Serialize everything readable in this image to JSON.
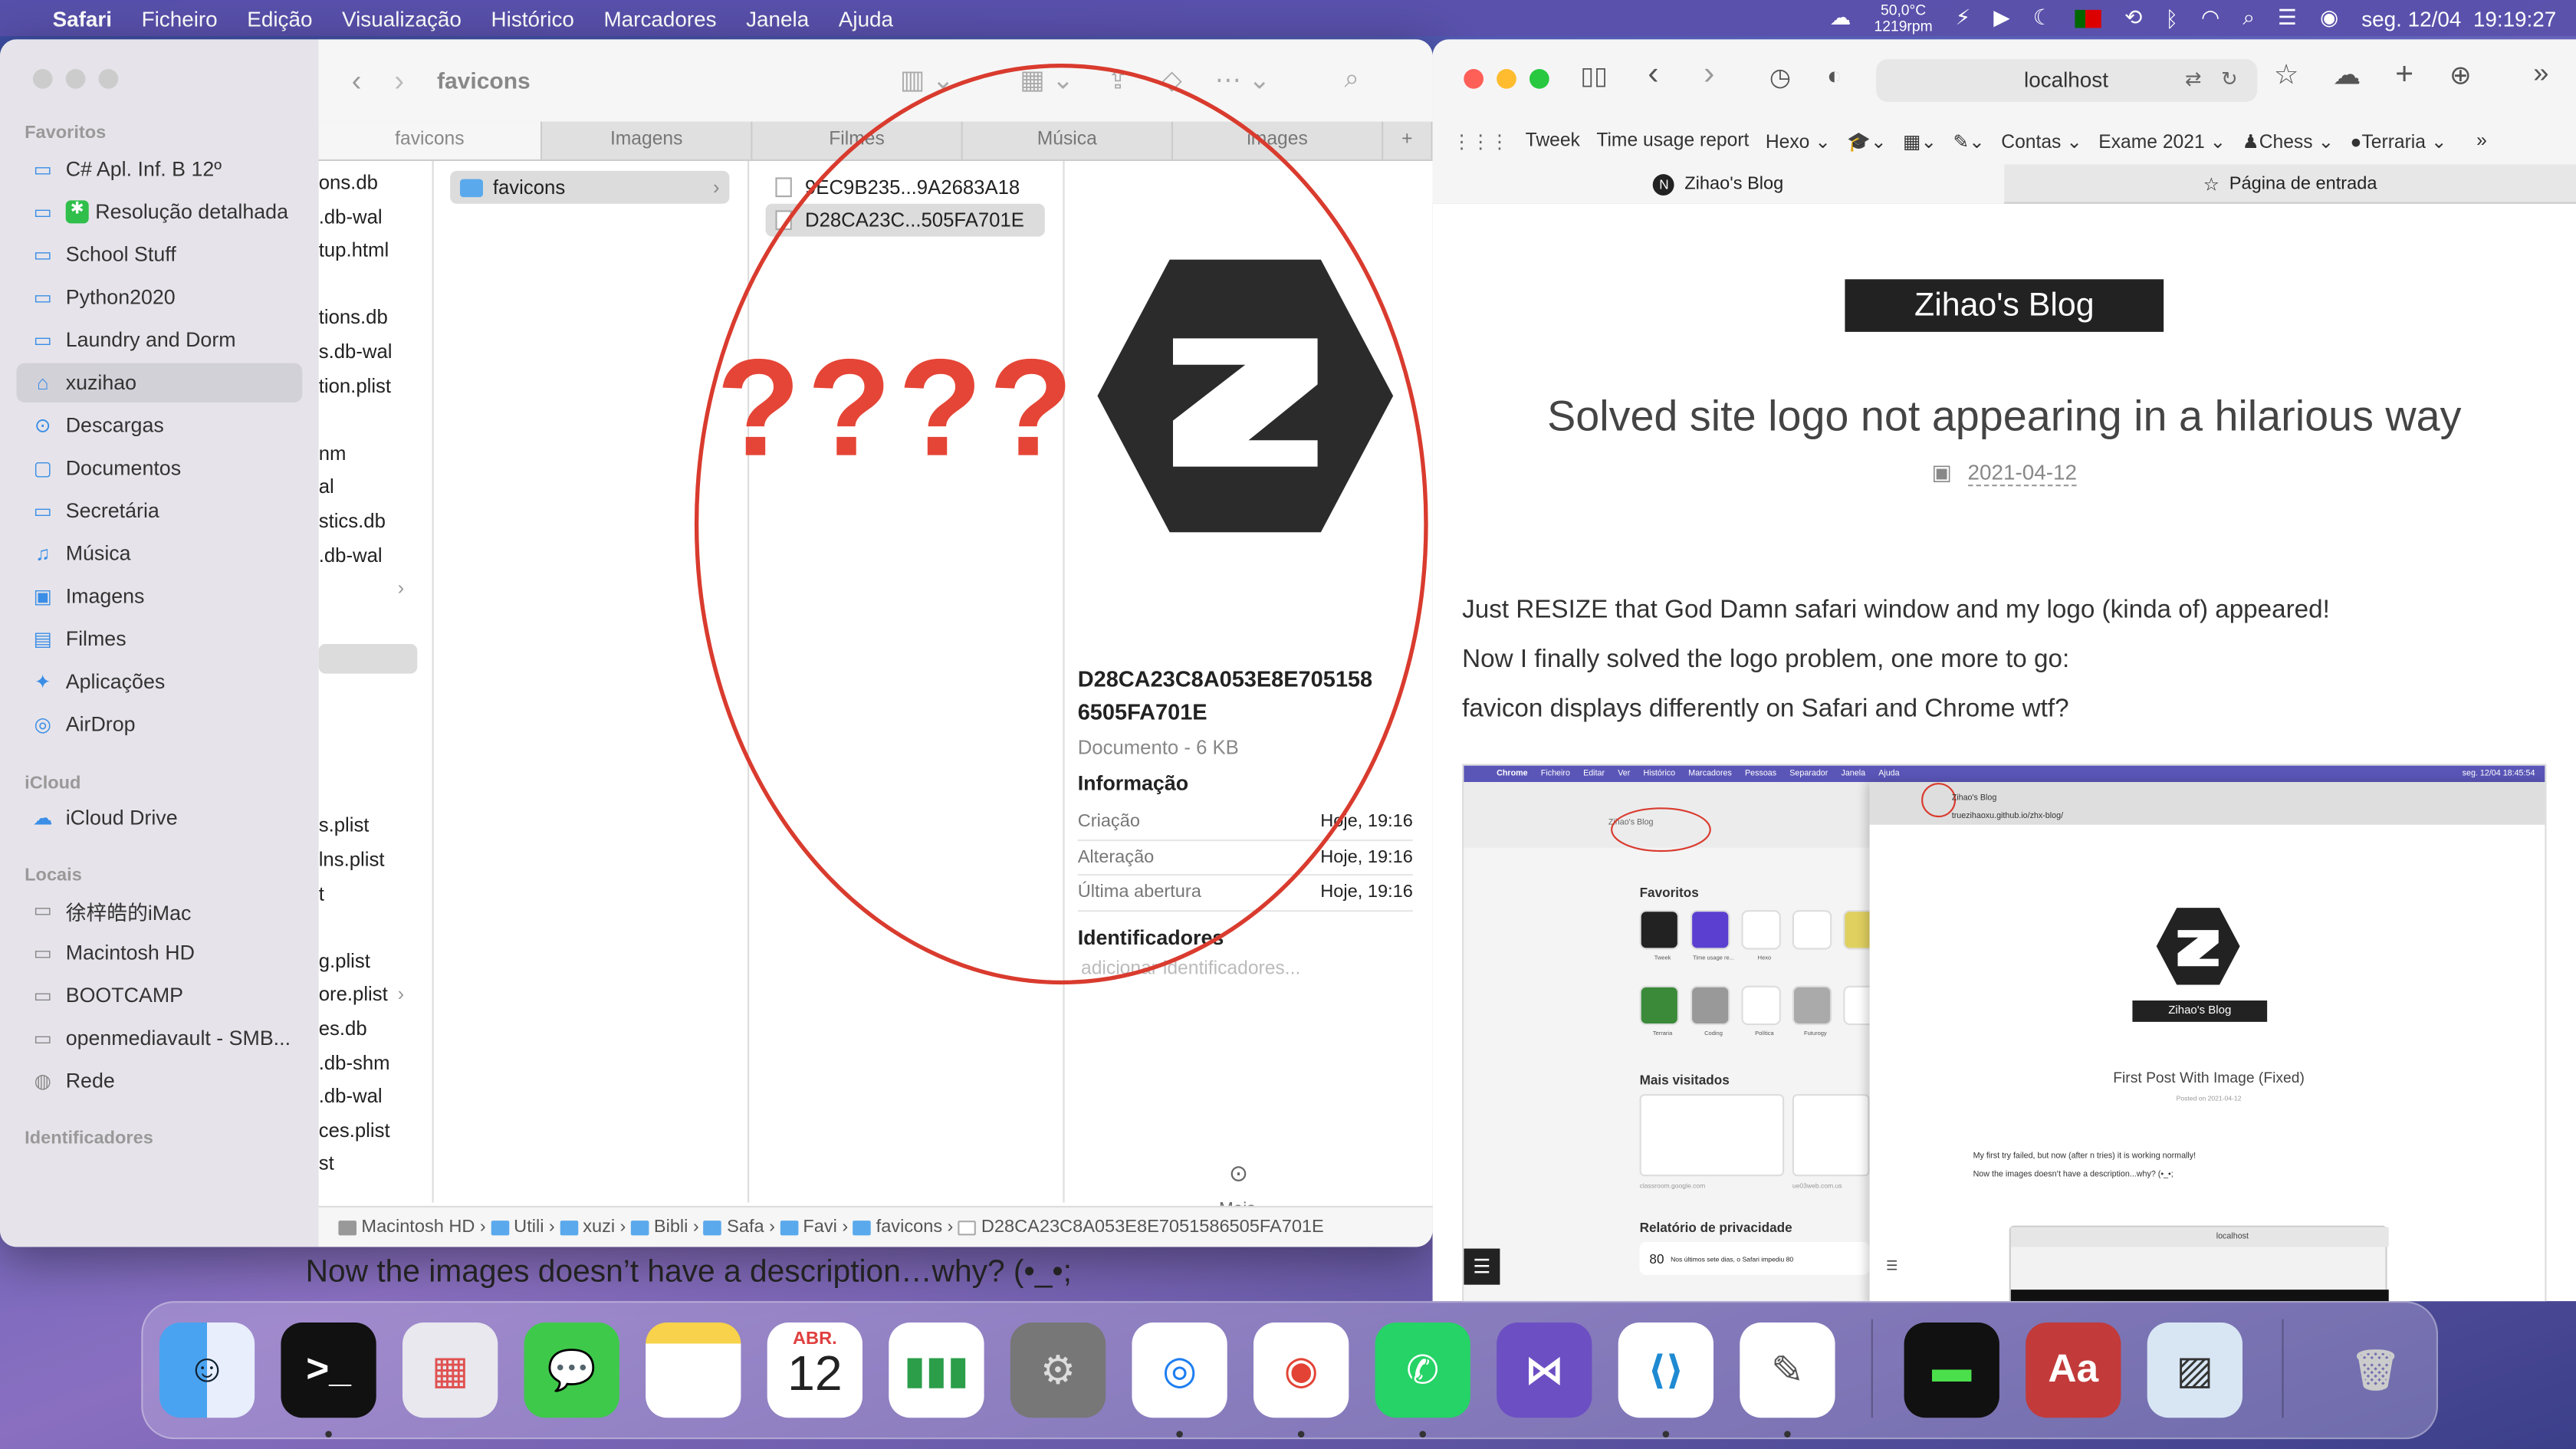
{
  "menubar": {
    "apple": "",
    "app": "Safari",
    "items": [
      "Ficheiro",
      "Edição",
      "Visualização",
      "Histórico",
      "Marcadores",
      "Janela",
      "Ajuda"
    ],
    "temp": "50,0°C",
    "rpm": "1219rpm",
    "datetime": "seg. 12/04  19:19:27"
  },
  "finder": {
    "title": "favicons",
    "tabs": [
      "favicons",
      "Imagens",
      "Filmes",
      "Música",
      "images"
    ],
    "sidebar": {
      "favoritos_label": "Favoritos",
      "favoritos": [
        "C# Apl. Inf. B 12º",
        "Resolução detalhada",
        "School Stuff",
        "Python2020",
        "Laundry and Dorm",
        "xuzihao",
        "Descargas",
        "Documentos",
        "Secretária",
        "Música",
        "Imagens",
        "Filmes",
        "Aplicações",
        "AirDrop"
      ],
      "icloud_label": "iCloud",
      "icloud": [
        "iCloud Drive"
      ],
      "locais_label": "Locais",
      "locais": [
        "徐梓皓的iMac",
        "Macintosh HD",
        "BOOTCAMP",
        "openmediavault - SMB...",
        "Rede"
      ],
      "ident_label": "Identificadores"
    },
    "col1": [
      "ons.db",
      ".db-wal",
      "tup.html",
      "",
      "tions.db",
      "s.db-wal",
      "tion.plist",
      "",
      "nm",
      "al",
      "stics.db",
      ".db-wal",
      "",
      "",
      "",
      "",
      "",
      "",
      "",
      "s.plist",
      "lns.plist",
      "t",
      "",
      "g.plist",
      "ore.plist",
      "es.db",
      ".db-shm",
      ".db-wal",
      "ces.plist",
      "st"
    ],
    "col2": [
      "favicons"
    ],
    "col3": [
      "9EC9B235...9A2683A18",
      "D28CA23C...505FA701E"
    ],
    "preview": {
      "overlay": "????",
      "filename": "D28CA23C8A053E8E705158 6505FA701E",
      "kind": "Documento - 6 KB",
      "info_label": "Informação",
      "rows": [
        {
          "k": "Criação",
          "v": "Hoje, 19:16"
        },
        {
          "k": "Alteração",
          "v": "Hoje, 19:16"
        },
        {
          "k": "Última abertura",
          "v": "Hoje, 19:16"
        }
      ],
      "tags_label": "Identificadores",
      "tags_placeholder": "adicionar identificadores...",
      "more": "Mais..."
    },
    "path": [
      "Macintosh HD",
      "Utili",
      "xuzi",
      "Bibli",
      "Safa",
      "Favi",
      "favicons",
      "D28CA23C8A053E8E7051586505FA701E"
    ]
  },
  "safari": {
    "url": "localhost",
    "favorites": [
      "Tweek",
      "Time usage report",
      "Hexo",
      "Contas",
      "Exame 2021",
      "Chess",
      "Terraria"
    ],
    "tab1": "Zihao's Blog",
    "tab2": "Página de entrada",
    "blog": {
      "site": "Zihao's Blog",
      "title": "Solved site logo not appearing in a hilarious way",
      "date": "2021-04-12",
      "paragraphs": [
        "Just RESIZE that God Damn safari window and my logo (kinda of) appeared!",
        "Now I finally solved the logo problem, one more to go:",
        "favicon displays differently on Safari and Chrome wtf?"
      ],
      "caption": "Now the images doesn’t have a description…why? (•_•;"
    },
    "embedded": {
      "chrome_menu": [
        "Chrome",
        "Ficheiro",
        "Editar",
        "Ver",
        "Histórico",
        "Marcadores",
        "Pessoas",
        "Separador",
        "Janela",
        "Ajuda"
      ],
      "chrome_datetime": "seg. 12/04  18:45:54",
      "url": "truezihaoxu.github.io/zhx-blog/",
      "tab": "Zihao's Blog",
      "favoritos_label": "Favoritos",
      "fav_tiles": [
        "Tweek",
        "Time usage re...",
        "Hexo",
        "",
        "",
        "Terraria",
        "Coding",
        "Política",
        "Futurogy",
        ""
      ],
      "mais_label": "Mais visitados",
      "visited": [
        "classroom.google.com",
        "ue03web.com.us"
      ],
      "privacy_label": "Relatório de privacidade",
      "privacy_count": "80",
      "privacy_text": "Nos últimos sete dias, o Safari impediu 80",
      "site": "Zihao's Blog",
      "post_title": "First Post With Image (Fixed)",
      "post_date": "Posted on 2021-04-12",
      "post_text1": "My first try failed, but now (after n tries) it is working normally!",
      "post_text2": "Now the images doesn’t have a description...why? (•_•;",
      "sub_url": "localhost"
    }
  },
  "dock": {
    "calendar_month": "ABR.",
    "calendar_day": "12",
    "apps": [
      "Finder",
      "Terminal",
      "Launchpad",
      "Messages",
      "Notes",
      "Calendar",
      "Numbers",
      "System Preferences",
      "Safari",
      "Chrome",
      "WhatsApp",
      "Visual Studio",
      "VS Code",
      "TextEdit",
      "Activity Monitor",
      "Dictionary",
      "Preview",
      "Trash"
    ]
  }
}
